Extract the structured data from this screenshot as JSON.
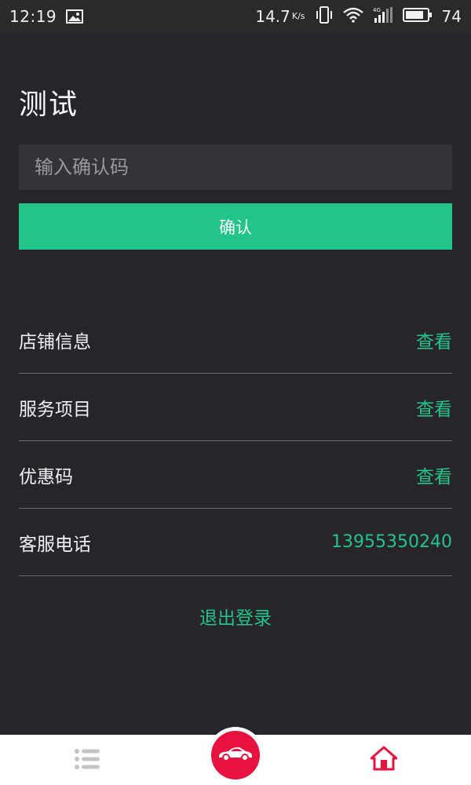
{
  "status_bar": {
    "time": "12:19",
    "speed": "14.7",
    "speed_unit": "K/s",
    "battery": "74",
    "icons": [
      "image-icon",
      "vibrate-icon",
      "wifi-icon",
      "signal-4g-icon",
      "battery-icon"
    ]
  },
  "page": {
    "title": "测试"
  },
  "code_form": {
    "placeholder": "输入确认码",
    "value": "",
    "confirm_label": "确认"
  },
  "info": {
    "rows": [
      {
        "label": "店铺信息",
        "action": "查看"
      },
      {
        "label": "服务项目",
        "action": "查看"
      },
      {
        "label": "优惠码",
        "action": "查看"
      },
      {
        "label": "客服电话",
        "action": "13955350240"
      }
    ]
  },
  "logout_label": "退出登录",
  "bottom_nav": {
    "icons": [
      "list-icon",
      "car-icon",
      "home-icon"
    ]
  },
  "colors": {
    "background": "#27252b",
    "accent": "#22c589",
    "input_bg": "#353238",
    "nav_red": "#e8123f"
  }
}
